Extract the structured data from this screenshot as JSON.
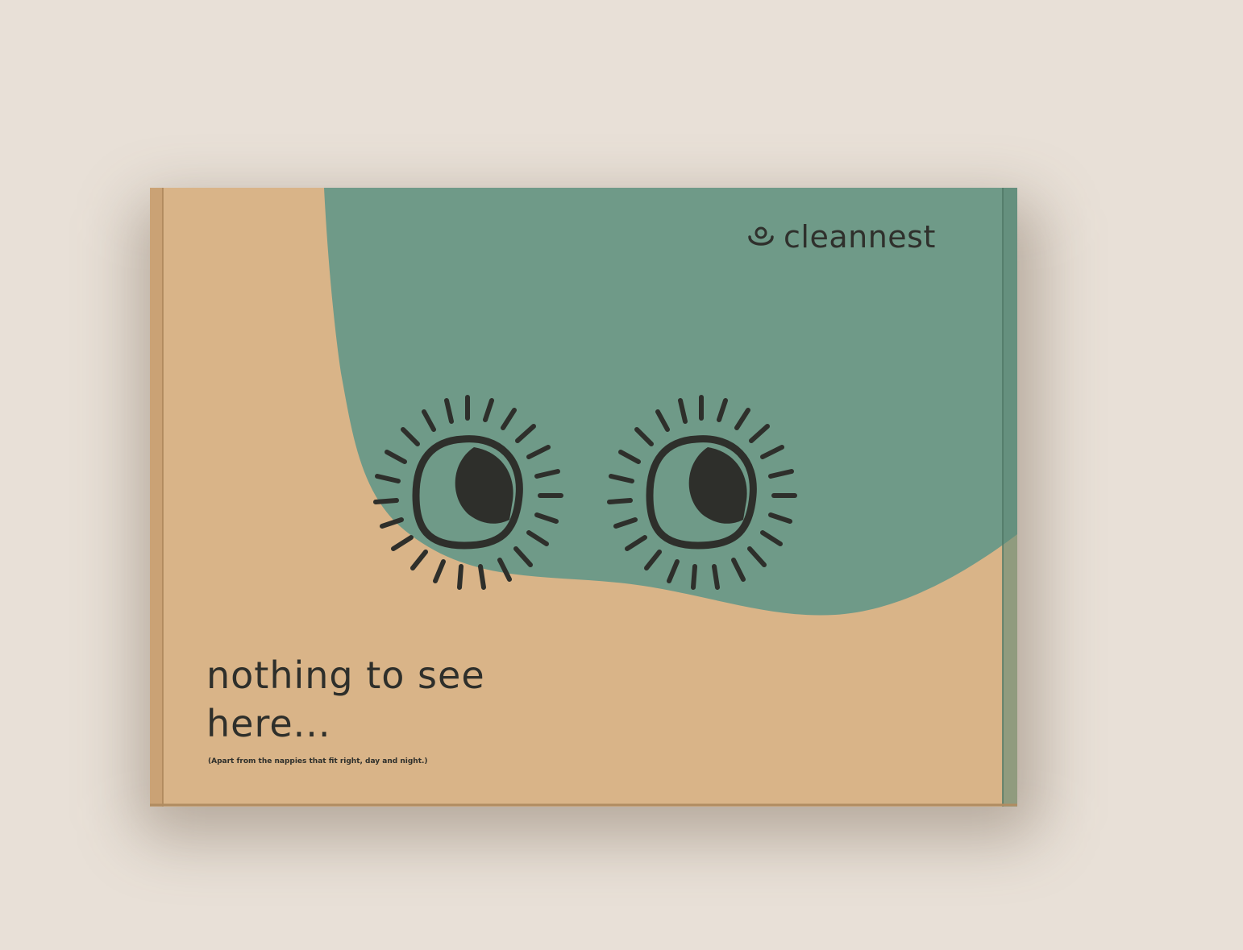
{
  "brand": {
    "name": "cleannest",
    "icon": "smiley-nest-logo-icon"
  },
  "headline": {
    "line1": "nothing  to see",
    "line2": "here..."
  },
  "subline": "(Apart from the nappies that fit right, day and night.)",
  "colors": {
    "background": "#e8e0d7",
    "kraft": "#d9b488",
    "green": "#6f9a88",
    "ink": "#2e2f2b"
  },
  "icons": [
    "left-eye-icon",
    "right-eye-icon"
  ]
}
